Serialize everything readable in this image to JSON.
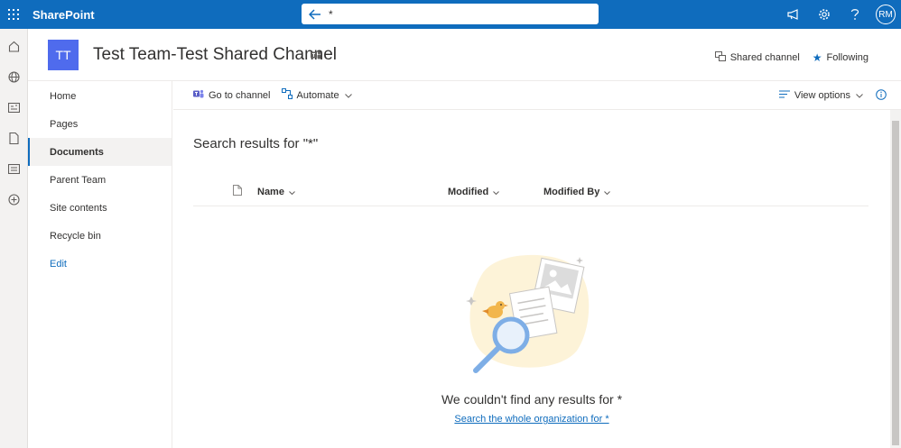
{
  "suite": {
    "app_name": "SharePoint",
    "search_query": "*",
    "avatar_initials": "RM",
    "icons": [
      "waffle-icon",
      "back-arrow-icon",
      "megaphone-icon",
      "gear-icon",
      "help-icon"
    ]
  },
  "site": {
    "logo_initials": "TT",
    "logo_color": "#4f6bed",
    "title": "Test Team-Test Shared Channel",
    "shared_channel_label": "Shared channel",
    "following_label": "Following"
  },
  "nav": {
    "items": [
      {
        "label": "Home"
      },
      {
        "label": "Pages"
      },
      {
        "label": "Documents",
        "selected": true
      },
      {
        "label": "Parent Team"
      },
      {
        "label": "Site contents"
      },
      {
        "label": "Recycle bin"
      }
    ],
    "edit_label": "Edit"
  },
  "commandbar": {
    "go_to_channel": "Go to channel",
    "automate": "Automate",
    "view_options": "View options"
  },
  "results": {
    "title": "Search results for \"*\"",
    "columns": {
      "name": "Name",
      "modified": "Modified",
      "modified_by": "Modified By"
    },
    "empty_message": "We couldn't find any results for *",
    "empty_link": "Search the whole organization for *"
  },
  "colors": {
    "brand": "#0f6cbd"
  }
}
